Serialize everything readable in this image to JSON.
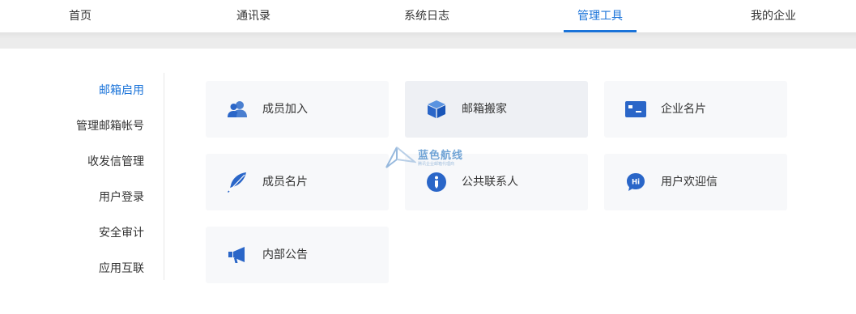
{
  "topnav": {
    "items": [
      {
        "label": "首页"
      },
      {
        "label": "通讯录"
      },
      {
        "label": "系统日志"
      },
      {
        "label": "管理工具",
        "active": true
      },
      {
        "label": "我的企业"
      }
    ]
  },
  "sidebar": {
    "items": [
      {
        "label": "邮箱启用",
        "active": true
      },
      {
        "label": "管理邮箱帐号"
      },
      {
        "label": "收发信管理"
      },
      {
        "label": "用户登录"
      },
      {
        "label": "安全审计"
      },
      {
        "label": "应用互联"
      }
    ]
  },
  "cards": [
    {
      "label": "成员加入",
      "icon": "users-icon"
    },
    {
      "label": "邮箱搬家",
      "icon": "box-icon"
    },
    {
      "label": "企业名片",
      "icon": "id-card-icon"
    },
    {
      "label": "成员名片",
      "icon": "feather-icon"
    },
    {
      "label": "公共联系人",
      "icon": "info-contact-icon"
    },
    {
      "label": "用户欢迎信",
      "icon": "hi-chat-icon"
    },
    {
      "label": "内部公告",
      "icon": "megaphone-icon"
    }
  ],
  "watermark": {
    "title": "蓝色航线",
    "subtitle": "腾讯企业邮箱代理商"
  },
  "colors": {
    "accent": "#1a73d9",
    "card_bg": "#f7f8fa",
    "text": "#333333"
  }
}
